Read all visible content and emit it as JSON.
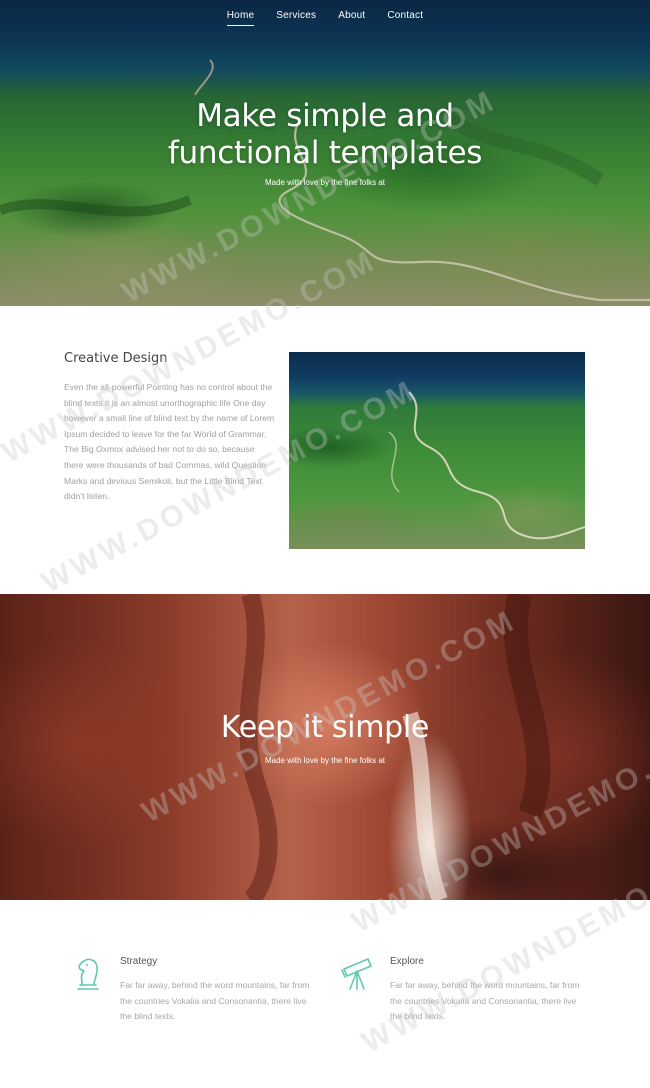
{
  "nav": {
    "items": [
      {
        "label": "Home",
        "active": true
      },
      {
        "label": "Services",
        "active": false
      },
      {
        "label": "About",
        "active": false
      },
      {
        "label": "Contact",
        "active": false
      }
    ]
  },
  "hero": {
    "title_line1": "Make simple and",
    "title_line2": "functional templates",
    "subtitle": "Made with love by the fine folks at"
  },
  "creative": {
    "heading": "Creative Design",
    "body": "Even the all-powerful Pointing has no control about the blind texts it is an almost unorthographic life One day however a small line of blind text by the name of Lorem Ipsum decided to leave for the far World of Grammar. The Big Oxmox advised her not to do so, because there were thousands of bad Commas, wild Question Marks and devious Semikoli, but the Little Blind Text didn’t listen."
  },
  "banner": {
    "title": "Keep it simple",
    "subtitle": "Made with love by the fine folks at"
  },
  "features": [
    {
      "title": "Strategy",
      "icon": "chess-knight-icon",
      "text": "Far far away, behind the word mountains, far from the countries Vokalia and Consonantia, there live the blind texts."
    },
    {
      "title": "Explore",
      "icon": "telescope-icon",
      "text": "Far far away, behind the word mountains, far from the countries Vokalia and Consonantia, there live the blind texts."
    }
  ],
  "colors": {
    "accent": "#5fc9b0",
    "heading": "#444444",
    "body_text": "#a0a0a0"
  },
  "watermark": "WWW.DOWNDEMO.COM"
}
